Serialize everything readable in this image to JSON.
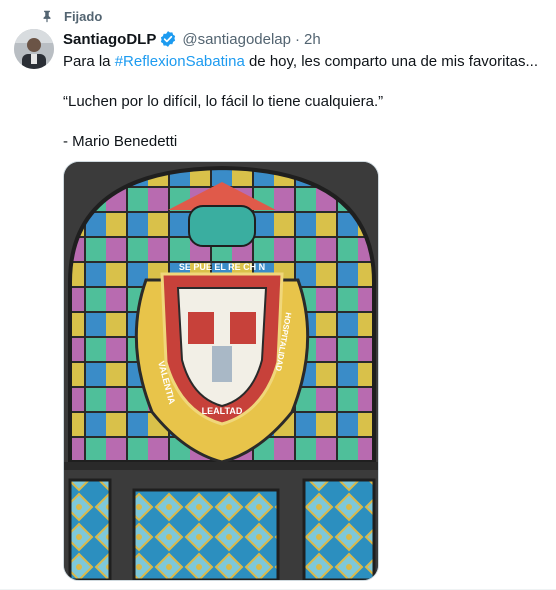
{
  "pinned": {
    "label": "Fijado",
    "icon": "pin-icon"
  },
  "author": {
    "name": "SantiagoDLP",
    "handle": "@santiagodelap",
    "separator": "·",
    "time": "2h",
    "verified_icon": "verified-badge-icon",
    "verified_color": "#1d9bf0"
  },
  "tweet": {
    "line1_before": "Para la ",
    "hashtag": "#ReflexionSabatina",
    "line1_after": " de hoy, les comparto una de mis favoritas...",
    "quote": "“Luchen por lo difícil, lo fácil lo tiene cualquiera.”",
    "attribution": "- Mario Benedetti"
  },
  "media": {
    "banner_top": "SE PUE EL RE CH N",
    "banner_left": "VALENTIA",
    "banner_bottom": "LEALTAD",
    "banner_right": "HOSPITALIDAD"
  },
  "colors": {
    "link": "#1d9bf0",
    "secondary_text": "#536471",
    "primary_text": "#0f1419"
  }
}
